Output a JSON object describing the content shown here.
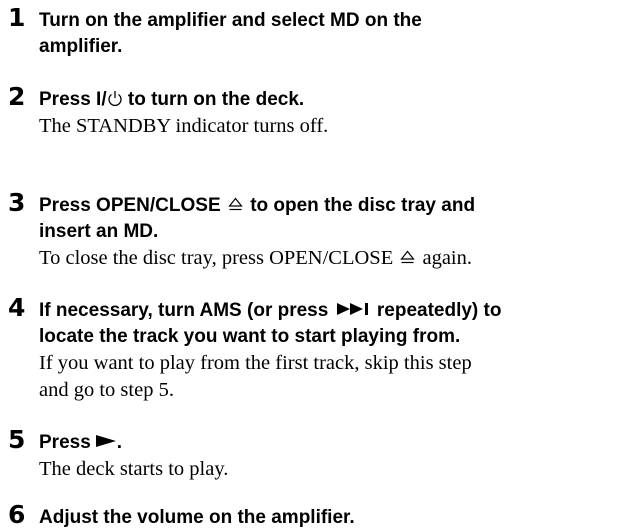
{
  "steps": [
    {
      "number": "1",
      "title_lines": [
        "Turn on the amplifier and select MD on the",
        "amplifier."
      ]
    },
    {
      "number": "2",
      "title_prefix": "Press I/",
      "title_suffix": " to turn on the deck.",
      "power_icon": "power-icon",
      "body": "The STANDBY indicator turns off."
    },
    {
      "number": "3",
      "title_a": "Press OPEN/CLOSE",
      "title_b": "to open the disc tray and",
      "title_line2": "insert an MD.",
      "eject_icon": "eject-icon",
      "body_a": "To close the disc tray, press OPEN/CLOSE",
      "body_b": "again."
    },
    {
      "number": "4",
      "title_a": "If necessary, turn AMS (or press",
      "title_b": "repeatedly) to",
      "title_line2": "locate the track you want to start playing from.",
      "next_icon": "skip-forward-icon",
      "body_lines": [
        "If you want to play from the first track, skip this step",
        "and go to step 5."
      ]
    },
    {
      "number": "5",
      "title_a": "Press",
      "title_b": ".",
      "play_icon": "play-icon",
      "body": "The deck starts to play."
    },
    {
      "number": "6",
      "title": "Adjust the volume on the amplifier."
    }
  ]
}
